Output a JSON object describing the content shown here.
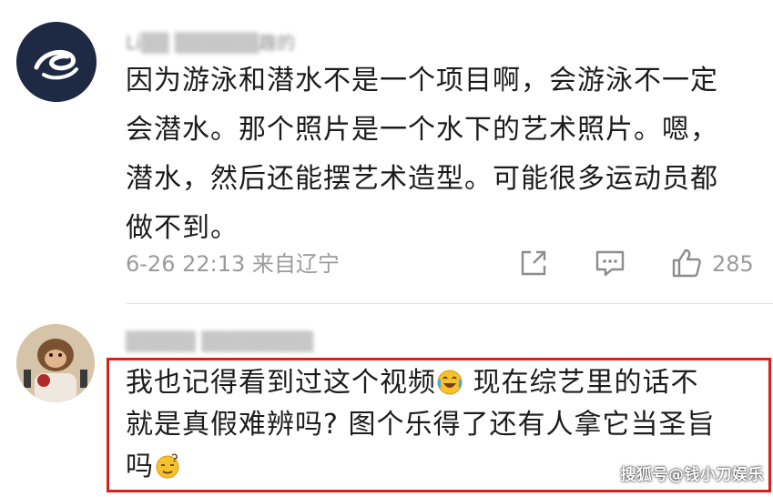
{
  "comments": [
    {
      "username": "Li▒▒ ▒▒▒▒▒▒趣的",
      "lines": [
        "因为游泳和潜水不是一个项目啊，会游泳不一定",
        "会潜水。那个照片是一个水下的艺术照片。嗯，",
        "潜水，然后还能摆艺术造型。可能很多运动员都",
        "做不到。"
      ],
      "timestamp": "6-26 22:13 来自辽宁",
      "like_count": "285",
      "avatar_icon": "swirl-logo-icon"
    },
    {
      "username": "▒▒▒▒▒ ▒▒▒▒▒▒▒▒",
      "lines": [
        {
          "before": "我也记得看到过这个视频",
          "emoji": "laughing-crying-emoji",
          "after": " 现在综艺里的话不"
        },
        {
          "before": "就是真假难辨吗? 图个乐得了还有人拿它当圣旨",
          "emoji": "",
          "after": ""
        },
        {
          "before": "吗",
          "emoji": "thinking-emoji",
          "after": ""
        }
      ],
      "avatar_icon": "monkey-photo-icon"
    }
  ],
  "watermark": "搜狐号@钱小刀娱乐",
  "colors": {
    "highlight_border": "#d8201f",
    "meta_text": "#9b9b9b",
    "body_text": "#1c1c1c"
  }
}
